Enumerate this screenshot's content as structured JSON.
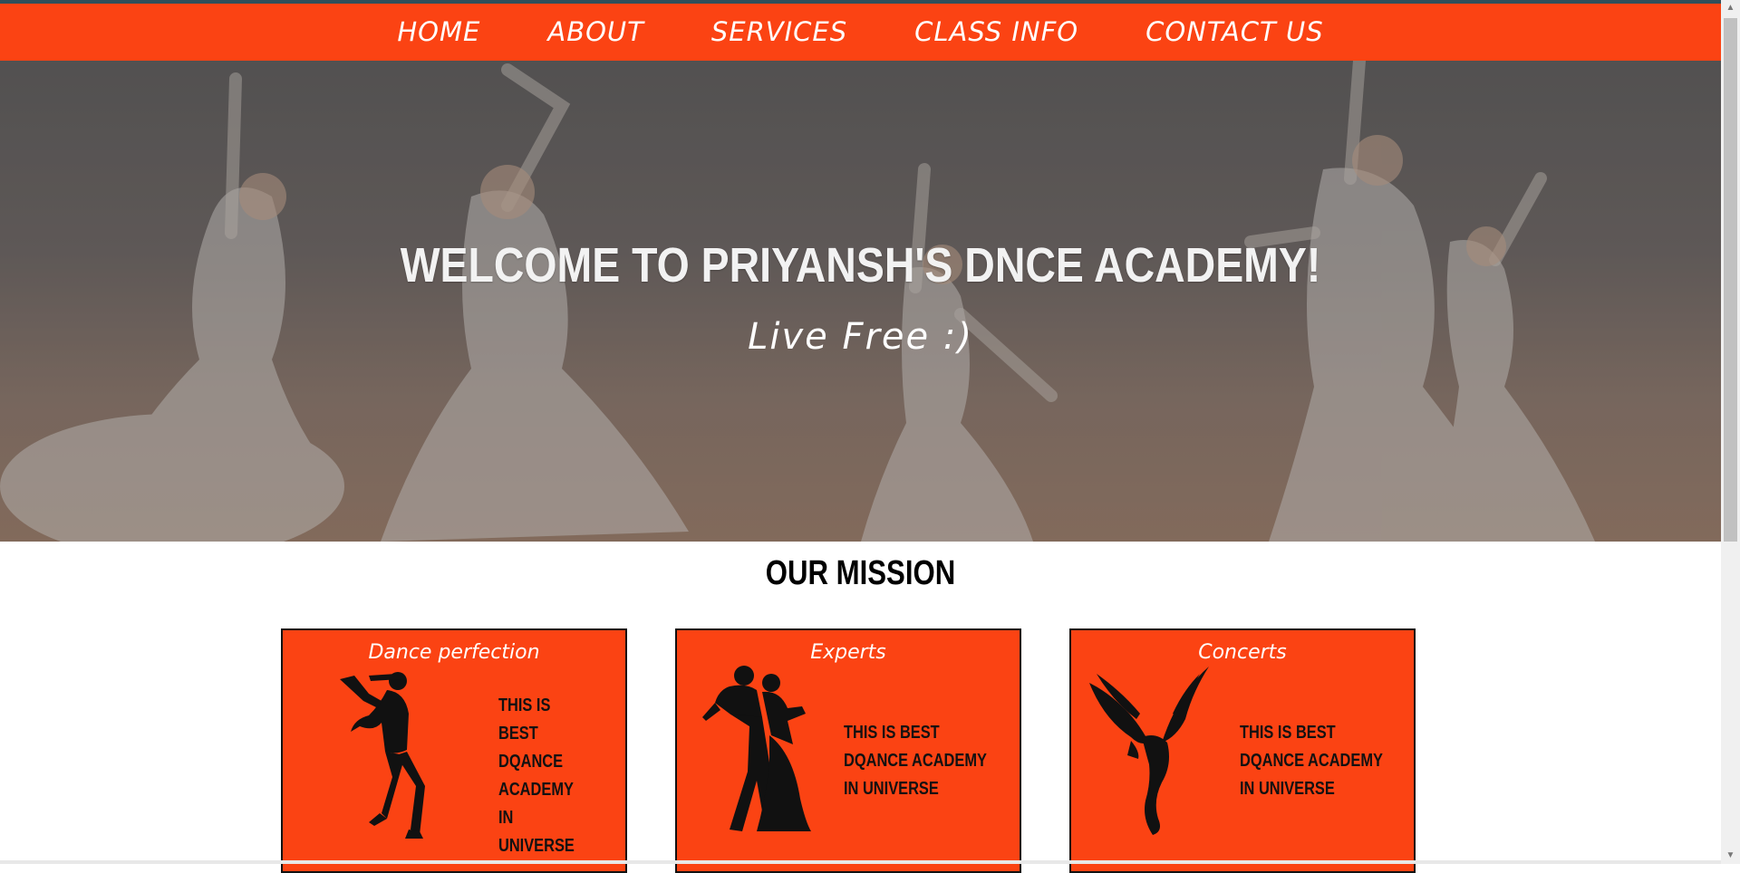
{
  "nav": {
    "items": [
      {
        "label": "HOME"
      },
      {
        "label": "ABOUT"
      },
      {
        "label": "SERVICES"
      },
      {
        "label": "CLASS INFO"
      },
      {
        "label": "CONTACT US"
      }
    ]
  },
  "hero": {
    "title": "WELCOME TO PRIYANSH'S DNCE ACADEMY!",
    "subtitle": "Live Free :)"
  },
  "mission": {
    "title": "OUR MISSION",
    "cards": [
      {
        "title": "Dance perfection",
        "text": "THIS IS BEST DQANCE ACADEMY IN UNIVERSE",
        "icon": "dancer-silhouette-icon"
      },
      {
        "title": "Experts",
        "text": "THIS IS BEST DQANCE ACADEMY IN UNIVERSE",
        "icon": "ballroom-couple-icon"
      },
      {
        "title": "Concerts",
        "text": "THIS IS BEST DQANCE ACADEMY IN UNIVERSE",
        "icon": "phoenix-logo-icon"
      }
    ]
  },
  "colors": {
    "accent": "#fb4313",
    "dark": "#111111"
  }
}
